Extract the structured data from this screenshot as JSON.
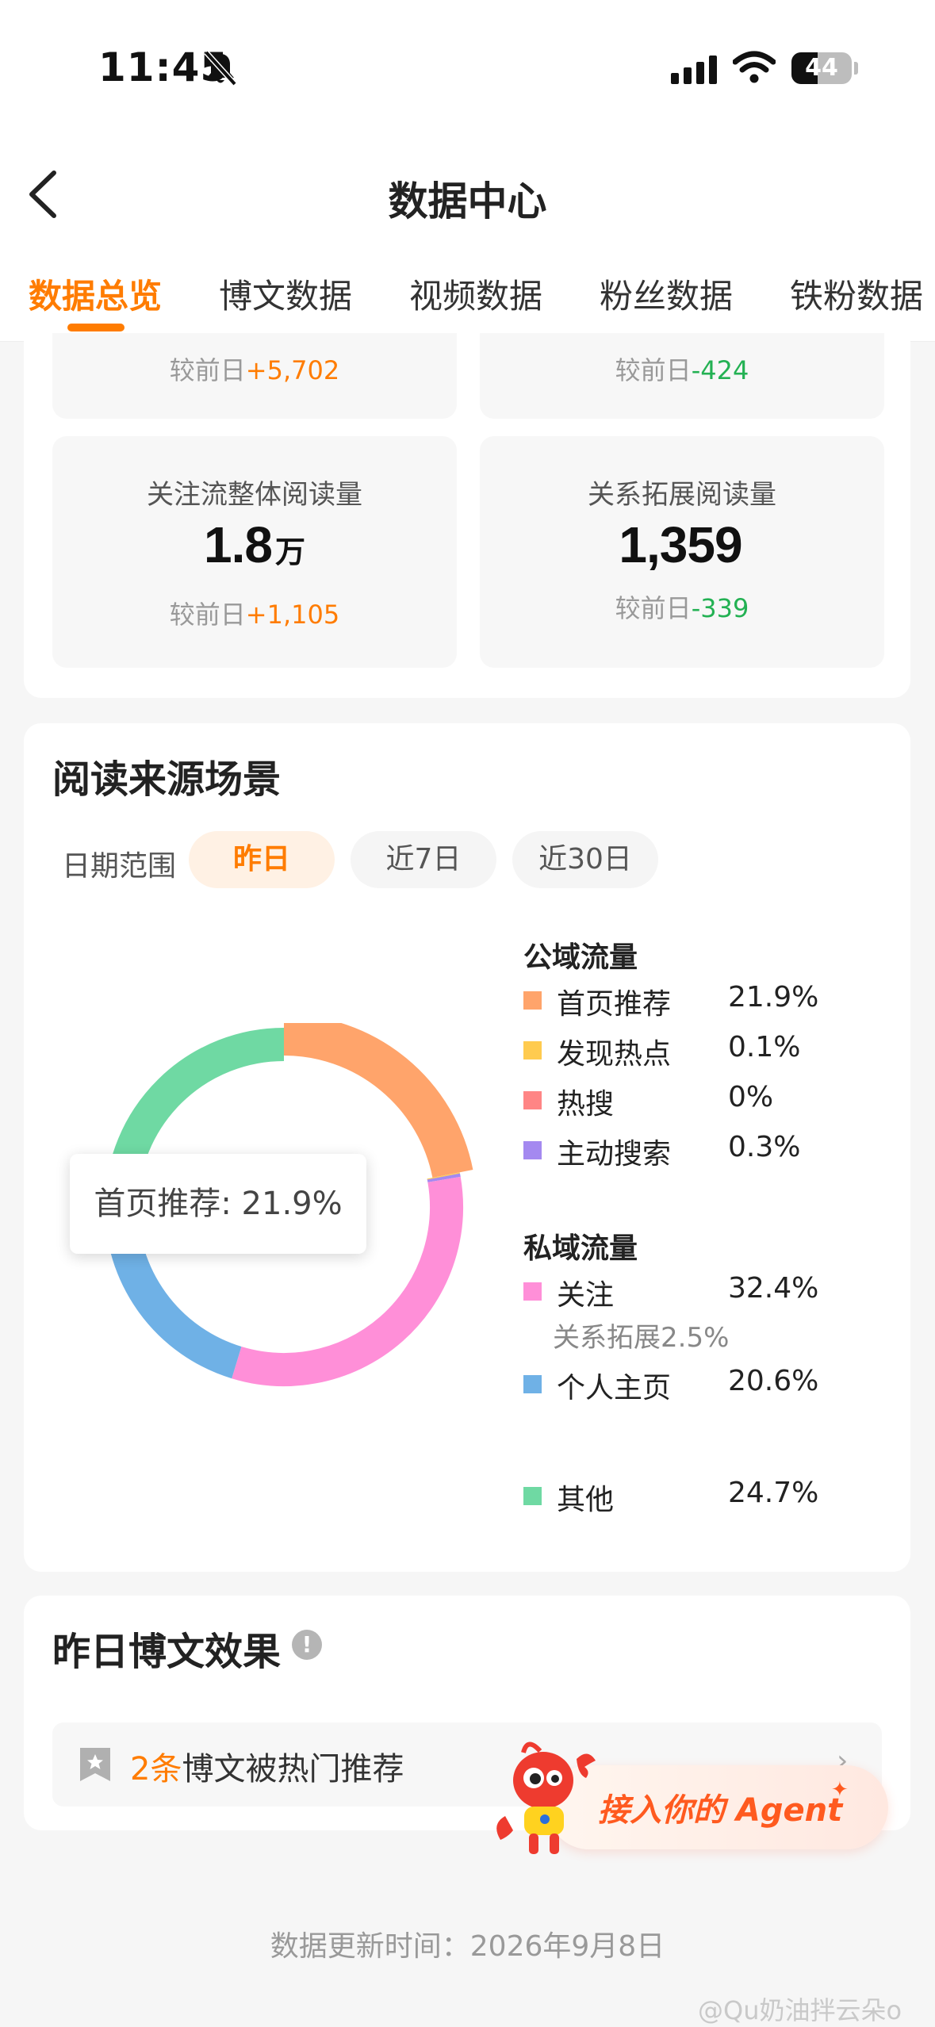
{
  "status_bar": {
    "time": "11:45",
    "battery": "44"
  },
  "nav": {
    "title": "数据中心"
  },
  "tabs": [
    {
      "label": "数据总览",
      "active": true
    },
    {
      "label": "博文数据"
    },
    {
      "label": "视频数据"
    },
    {
      "label": "粉丝数据"
    },
    {
      "label": "铁粉数据"
    }
  ],
  "overview": {
    "top_partial": [
      {
        "delta_label": "较前日",
        "delta": "+5,702"
      },
      {
        "delta_label": "较前日",
        "delta": "-424"
      }
    ],
    "stats": [
      {
        "label": "关注流整体阅读量",
        "value": "1.8",
        "unit": "万",
        "delta_label": "较前日",
        "delta": "+1,105"
      },
      {
        "label": "关系拓展阅读量",
        "value": "1,359",
        "unit": "",
        "delta_label": "较前日",
        "delta": "-339"
      }
    ]
  },
  "reading_source": {
    "title": "阅读来源场景",
    "range_label": "日期范围",
    "chips": [
      "昨日",
      "近7日",
      "近30日"
    ],
    "active_chip": "昨日",
    "tooltip": "首页推荐: 21.9%",
    "public_label": "公域流量",
    "private_label": "私域流量",
    "public_items": [
      {
        "name": "首页推荐",
        "pct": "21.9%",
        "color": "#ffa46b"
      },
      {
        "name": "发现热点",
        "pct": "0.1%",
        "color": "#ffcb4f"
      },
      {
        "name": "热搜",
        "pct": "0%",
        "color": "#ff8585"
      },
      {
        "name": "主动搜索",
        "pct": "0.3%",
        "color": "#a489f0"
      }
    ],
    "private_items": [
      {
        "name": "关注",
        "pct": "32.4%",
        "color": "#ff8fd8"
      },
      {
        "name": "个人主页",
        "pct": "20.6%",
        "color": "#6fb1e6"
      }
    ],
    "private_sub": "关系拓展2.5%",
    "other": {
      "name": "其他",
      "pct": "24.7%",
      "color": "#6fd9a3"
    }
  },
  "chart_data": {
    "type": "pie",
    "variant": "donut",
    "categories": [
      "首页推荐",
      "发现热点",
      "热搜",
      "主动搜索",
      "关注",
      "个人主页",
      "其他"
    ],
    "values": [
      21.9,
      0.1,
      0,
      0.3,
      32.4,
      20.6,
      24.7
    ],
    "colors": [
      "#ffa46b",
      "#ffcb4f",
      "#ff8585",
      "#a489f0",
      "#ff8fd8",
      "#6fb1e6",
      "#6fd9a3"
    ],
    "highlighted": "首页推荐",
    "legend_position": "right"
  },
  "yesterday_posts": {
    "title": "昨日博文效果",
    "hot_count": "2条",
    "hot_text": "博文被热门推荐"
  },
  "agent": {
    "label": "接入你的 Agent"
  },
  "footer": {
    "label": "数据更新时间：",
    "date": "2026年9月8日"
  },
  "watermark": "@Qu奶油拌云朵o"
}
